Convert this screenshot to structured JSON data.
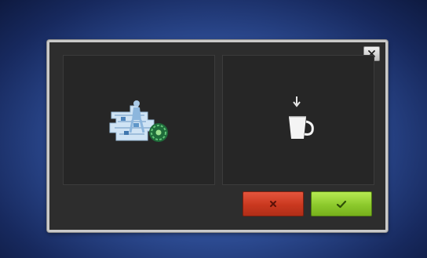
{
  "dialog": {
    "close_button": {
      "icon": "close-icon"
    },
    "left_panel": {
      "icon": "embroidery-design-icon"
    },
    "right_panel": {
      "icon": "bobbin-cup-arrow-icon"
    },
    "cancel_button": {
      "icon": "close-icon",
      "color": "#c9381f"
    },
    "ok_button": {
      "icon": "checkmark-icon",
      "color": "#8cc92c"
    }
  },
  "colors": {
    "background": "#2f4f98",
    "dialog_fill": "#2d2d2d",
    "dialog_border": "#c9c9c9"
  }
}
